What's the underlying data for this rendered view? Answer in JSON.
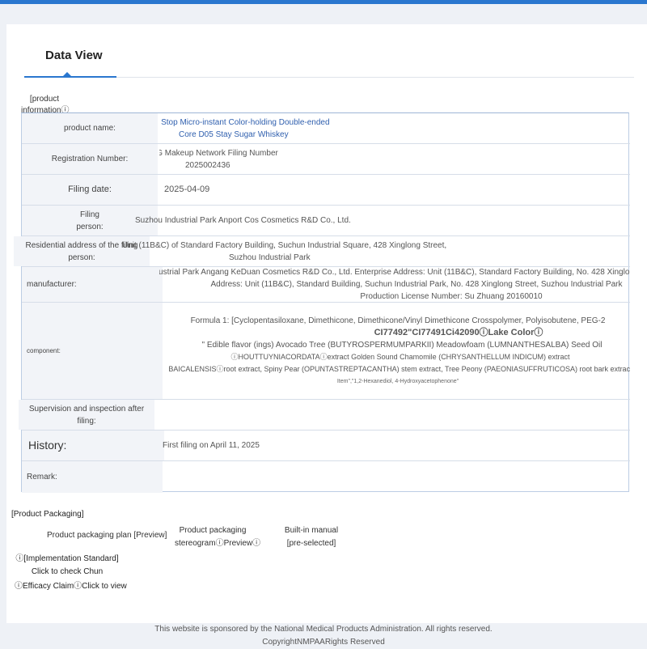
{
  "tab": {
    "title": "Data View"
  },
  "section_label": "[product informationⓘ",
  "rows": {
    "product_name": {
      "label": "product name:",
      "value_line1": "Misty Stop Micro-instant Color-holding Double-ended",
      "value_line2": "Core D05 Stay Sugar Whiskey"
    },
    "registration": {
      "label": "Registration Number:",
      "value_line1": "SuG Makeup Network Filing Number",
      "value_line2": "2025002436"
    },
    "filing_date": {
      "label": "Filing date:",
      "value": "2025-04-09"
    },
    "filing_person": {
      "label": "Filing person:",
      "value": "Suzhou Industrial Park Anport Cos Cosmetics R&D Co., Ltd."
    },
    "address": {
      "label": "Residential address of the filing person:",
      "value_line1": "Unit (11B&C) of Standard Factory Building, Suchun Industrial Square, 428 Xinglong Street,",
      "value_line2": "Suzhou Industrial Park"
    },
    "manufacturer": {
      "label": "manufacturer:",
      "line1": "Enterprise Name: Suzhou Industrial Park Angang KeDuan Cosmetics R&D Co., Ltd. Enterprise Address: Unit (11B&C), Standard Factory Building, No. 428 Xinglong Street, Suzhou Industrial Park",
      "line2": "Address: Unit (11B&C), Standard Building, Suchun Industrial Park, No. 428 Xinglong Street, Suzhou Industrial Park",
      "line3": "Production License Number: Su Zhuang 20160010"
    },
    "component": {
      "label": "component:",
      "line1": "Formula 1: [Cyclopentasiloxane, Dimethicone, Dimethicone/Vinyl Dimethicone Crosspolymer, Polyisobutene, PEG-2",
      "line2": "CI77492\"CI77491Ci42090ⓘLake Colorⓘ",
      "line3": "\" Edible flavor (ings)   Avocado Tree (BUTYROSPERMUMPARKII) Meadowfoam (LUMNANTHESALBA) Seed Oil",
      "line4": "ⓘHOUTTUYNIACORDATAⓘextract Golden Sound Chamomile (CHRYSANTHELLUM INDICUM) extract",
      "line5": "BAICALENSISⓘroot extract, Spiny Pear (OPUNTASTREPTACANTHA) stem extract, Tree Peony (PAEONIASUFFRUTICOSA) root bark extract",
      "line6": "Item\",\"1,2-Hexanediol, 4-Hydroxyacetophenone\""
    },
    "supervision": {
      "label": "Supervision and inspection after filing:",
      "value": ""
    },
    "history": {
      "label": "History:",
      "value": "First filing on April 11, 2025"
    },
    "remark": {
      "label": "Remark:",
      "value": ""
    }
  },
  "packaging": {
    "title": "[Product Packaging]",
    "plan": "Product packaging plan [Preview]",
    "stereogram": "Product packaging stereogramⓘPreviewⓘ",
    "manual": "Built-in manual [pre-selected]"
  },
  "links": {
    "impl_standard": "ⓘ[Implementation Standard] Click to check Chun",
    "efficacy": "ⓘEfficacy ClaimⓘClick to view"
  },
  "footer": "This website is sponsored by the National Medical Products Administration. All rights reserved. CopyrightNMPAARights Reserved",
  "colors": {
    "accent": "#2a77cf",
    "link_blue": "#2f5fae"
  }
}
